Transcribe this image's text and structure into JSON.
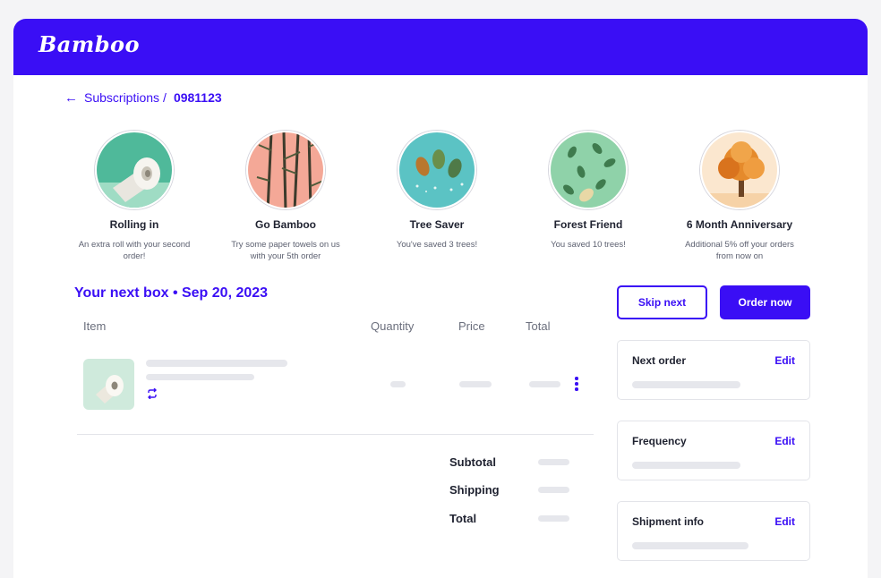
{
  "app": {
    "logo": "Bamboo"
  },
  "breadcrumb": {
    "back_icon": "arrow-left-icon",
    "parent": "Subscriptions",
    "separator": "/",
    "current": "0981123"
  },
  "badges": [
    {
      "title": "Rolling in",
      "desc": "An extra roll with your second order!",
      "icon": "toilet-roll-icon"
    },
    {
      "title": "Go Bamboo",
      "desc": "Try some paper towels on us with your 5th order",
      "icon": "bamboo-icon"
    },
    {
      "title": "Tree Saver",
      "desc": "You've saved 3 trees!",
      "icon": "leaves-icon"
    },
    {
      "title": "Forest Friend",
      "desc": "You saved 10 trees!",
      "icon": "falling-leaves-icon"
    },
    {
      "title": "6 Month Anniversary",
      "desc": "Additional 5% off your orders from now on",
      "icon": "autumn-tree-icon"
    }
  ],
  "next_box": {
    "title": "Your next box • Sep 20, 2023",
    "columns": [
      "Item",
      "Quantity",
      "Price",
      "Total"
    ],
    "summary": {
      "subtotal": "Subtotal",
      "shipping": "Shipping",
      "total": "Total"
    }
  },
  "actions": {
    "skip": "Skip next",
    "order": "Order now"
  },
  "cards": [
    {
      "title": "Next order",
      "edit": "Edit"
    },
    {
      "title": "Frequency",
      "edit": "Edit"
    },
    {
      "title": "Shipment info",
      "edit": "Edit"
    }
  ],
  "colors": {
    "brand": "#3a0ef5",
    "skeleton": "#e6e7ec"
  }
}
